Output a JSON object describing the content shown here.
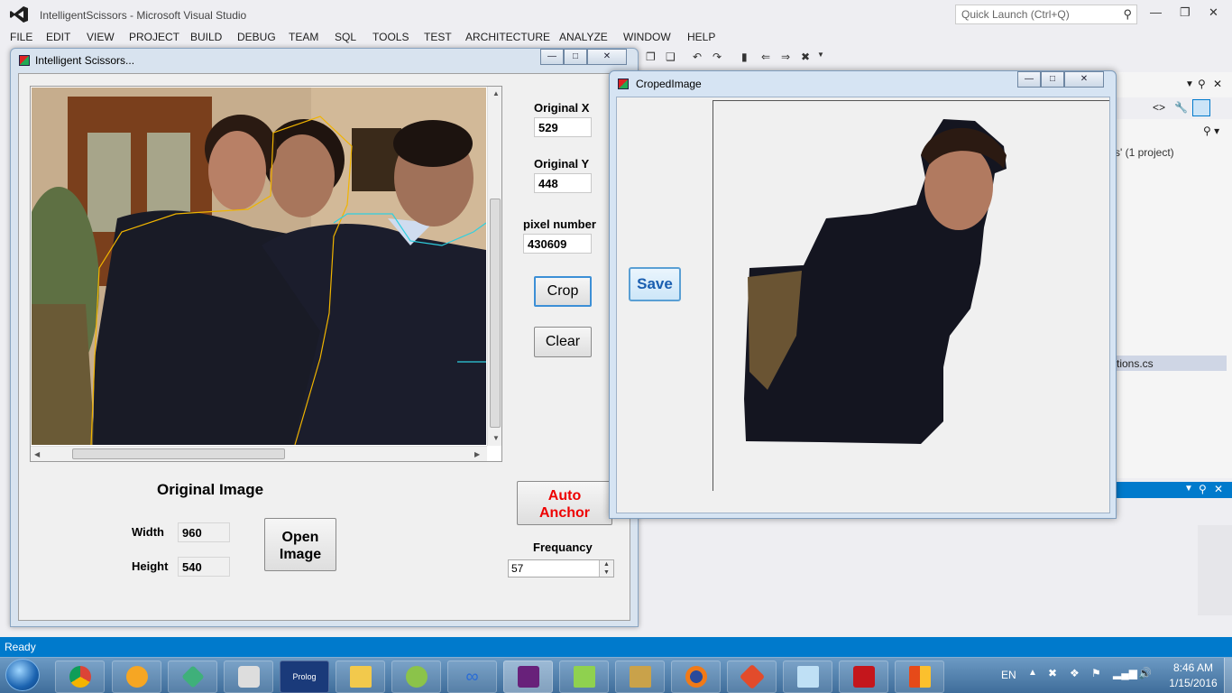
{
  "vs": {
    "title": "IntelligentScissors - Microsoft Visual Studio",
    "quick_launch_placeholder": "Quick Launch (Ctrl+Q)",
    "menu": [
      "FILE",
      "EDIT",
      "VIEW",
      "PROJECT",
      "BUILD",
      "DEBUG",
      "TEAM",
      "SQL",
      "TOOLS",
      "TEST",
      "ARCHITECTURE",
      "ANALYZE",
      "WINDOW",
      "HELP"
    ],
    "solution_project_text": "s' (1 project)",
    "solution_file_text": "tions.cs",
    "status": "Ready"
  },
  "scissors_window": {
    "title": "Intelligent Scissors...",
    "original_x_label": "Original X",
    "original_x_value": "529",
    "original_y_label": "Original Y",
    "original_y_value": "448",
    "pixel_number_label": "pixel number",
    "pixel_number_value": "430609",
    "crop_label": "Crop",
    "clear_label": "Clear",
    "original_image_label": "Original Image",
    "width_label": "Width",
    "width_value": "960",
    "height_label": "Height",
    "height_value": "540",
    "open_image_label_1": "Open",
    "open_image_label_2": "Image",
    "auto_anchor_label_1": "Auto",
    "auto_anchor_label_2": "Anchor",
    "frequancy_label": "Frequancy",
    "frequancy_value": "57"
  },
  "croped_window": {
    "title": "CropedImage",
    "save_label": "Save"
  },
  "taskbar": {
    "apps": [
      "chrome",
      "blender",
      "vlc-like",
      "media-player",
      "Prolog",
      "file-explorer",
      "eclipse",
      "infinity",
      "visual-studio",
      "notepad++",
      "tools",
      "firefox",
      "git",
      "notes",
      "acrobat",
      "office"
    ],
    "prolog_label": "Prolog",
    "language": "EN",
    "time": "8:46 AM",
    "date": "1/15/2016"
  },
  "colors": {
    "vs_blue": "#007acc",
    "auto_anchor_red": "#e00000",
    "save_blue": "#1a5eb0"
  }
}
